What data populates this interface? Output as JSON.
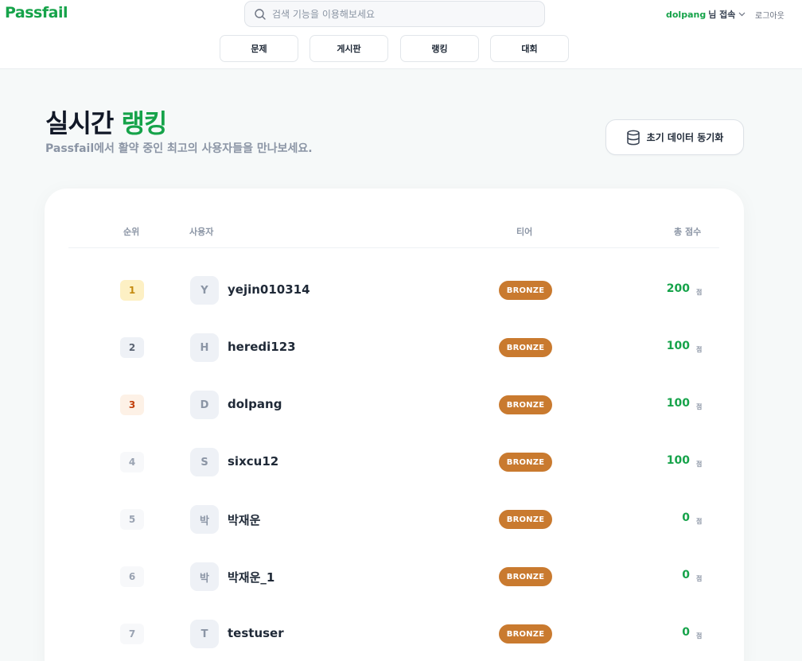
{
  "header": {
    "logo": "Passfail",
    "search": {
      "placeholder": "검색 기능을 이용해보세요",
      "value": ""
    },
    "user": {
      "name": "dolpang",
      "suffix": "님 접속"
    },
    "logout_label": "로그아웃",
    "nav": [
      {
        "label": "문제"
      },
      {
        "label": "게시판"
      },
      {
        "label": "랭킹"
      },
      {
        "label": "대회"
      }
    ]
  },
  "hero": {
    "title_prefix": "실시간",
    "title_accent": "랭킹",
    "subtitle": "Passfail에서 활약 중인 최고의 사용자들을 만나보세요.",
    "sync_button_label": "초기 데이터 동기화"
  },
  "table": {
    "columns": {
      "rank": "순위",
      "user": "사용자",
      "tier": "티어",
      "score": "총 점수"
    },
    "rows": [
      {
        "rank": "1",
        "avatar": "Y",
        "username": "yejin010314",
        "tier": "BRONZE",
        "score": "200",
        "unit": "점"
      },
      {
        "rank": "2",
        "avatar": "H",
        "username": "heredi123",
        "tier": "BRONZE",
        "score": "100",
        "unit": "점"
      },
      {
        "rank": "3",
        "avatar": "D",
        "username": "dolpang",
        "tier": "BRONZE",
        "score": "100",
        "unit": "점"
      },
      {
        "rank": "4",
        "avatar": "S",
        "username": "sixcu12",
        "tier": "BRONZE",
        "score": "100",
        "unit": "점"
      },
      {
        "rank": "5",
        "avatar": "박",
        "username": "박재운",
        "tier": "BRONZE",
        "score": "0",
        "unit": "점"
      },
      {
        "rank": "6",
        "avatar": "박",
        "username": "박재운_1",
        "tier": "BRONZE",
        "score": "0",
        "unit": "점"
      },
      {
        "rank": "7",
        "avatar": "T",
        "username": "testuser",
        "tier": "BRONZE",
        "score": "0",
        "unit": "점"
      }
    ]
  },
  "colors": {
    "brand": "#16a34a",
    "tier_bronze": "#c97a2f",
    "rank_gold_bg": "#fdf0c4",
    "rank_gold_text": "#c48a10",
    "rank_silver_bg": "#eef1f6",
    "rank_silver_text": "#5b6473",
    "rank_bronze_bg": "#fdf1e6",
    "rank_bronze_text": "#c2410c",
    "rank_default_bg": "#f7f8fa",
    "rank_default_text": "#9aa3b2"
  },
  "icons": {
    "search": "search-icon",
    "chevron": "chevron-down-icon",
    "sync": "database-icon"
  }
}
